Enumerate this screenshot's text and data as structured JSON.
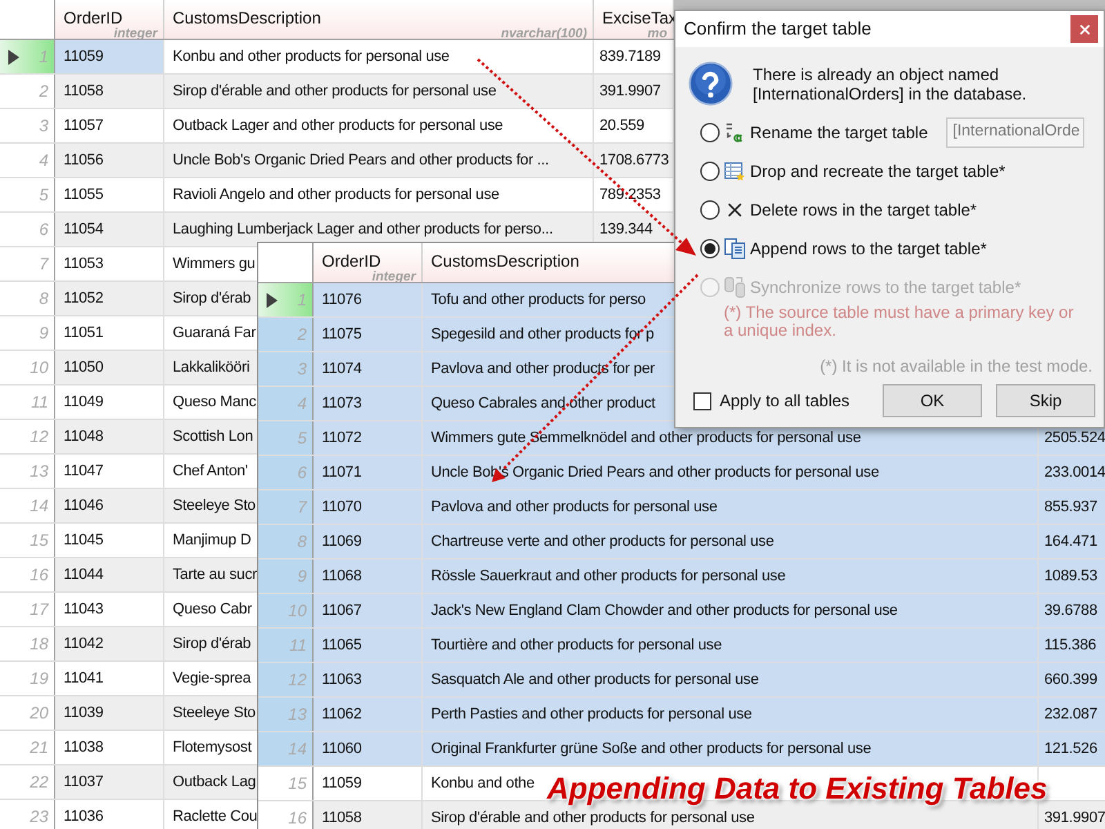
{
  "back_table": {
    "columns": [
      {
        "name": "OrderID",
        "type": "integer"
      },
      {
        "name": "CustomsDescription",
        "type": "nvarchar(100)"
      },
      {
        "name": "ExciseTax",
        "type": "mo"
      }
    ],
    "rows": [
      {
        "number": "1",
        "order_id": "11059",
        "description": "Konbu and other products for personal use",
        "excise_tax": "839.7189",
        "current": true,
        "cell_focused": true
      },
      {
        "number": "2",
        "order_id": "11058",
        "description": "Sirop d'érable and other products for personal use",
        "excise_tax": "391.9907",
        "current": false,
        "cell_focused": false
      },
      {
        "number": "3",
        "order_id": "11057",
        "description": "Outback Lager and other products for personal use",
        "excise_tax": "20.559",
        "current": false,
        "cell_focused": false
      },
      {
        "number": "4",
        "order_id": "11056",
        "description": "Uncle Bob's Organic Dried Pears and other products for ...",
        "excise_tax": "1708.6773",
        "current": false,
        "cell_focused": false
      },
      {
        "number": "5",
        "order_id": "11055",
        "description": "Ravioli Angelo and other products for personal use",
        "excise_tax": "789.2353",
        "current": false,
        "cell_focused": false
      },
      {
        "number": "6",
        "order_id": "11054",
        "description": "Laughing Lumberjack Lager and other products for perso...",
        "excise_tax": "139.344",
        "current": false,
        "cell_focused": false
      },
      {
        "number": "7",
        "order_id": "11053",
        "description": "Wimmers gu",
        "current": false,
        "cell_focused": false
      },
      {
        "number": "8",
        "order_id": "11052",
        "description": "Sirop d'érab",
        "current": false,
        "cell_focused": false
      },
      {
        "number": "9",
        "order_id": "11051",
        "description": "Guaraná Far",
        "current": false,
        "cell_focused": false
      },
      {
        "number": "10",
        "order_id": "11050",
        "description": "Lakkalikööri",
        "current": false,
        "cell_focused": false
      },
      {
        "number": "11",
        "order_id": "11049",
        "description": "Queso Manc",
        "current": false,
        "cell_focused": false
      },
      {
        "number": "12",
        "order_id": "11048",
        "description": "Scottish Lon",
        "current": false,
        "cell_focused": false
      },
      {
        "number": "13",
        "order_id": "11047",
        "description": "Chef Anton'",
        "current": false,
        "cell_focused": false
      },
      {
        "number": "14",
        "order_id": "11046",
        "description": "Steeleye Sto",
        "current": false,
        "cell_focused": false
      },
      {
        "number": "15",
        "order_id": "11045",
        "description": "Manjimup D",
        "current": false,
        "cell_focused": false
      },
      {
        "number": "16",
        "order_id": "11044",
        "description": "Tarte au sucr",
        "current": false,
        "cell_focused": false
      },
      {
        "number": "17",
        "order_id": "11043",
        "description": "Queso Cabr",
        "current": false,
        "cell_focused": false
      },
      {
        "number": "18",
        "order_id": "11042",
        "description": "Sirop d'érab",
        "current": false,
        "cell_focused": false
      },
      {
        "number": "19",
        "order_id": "11041",
        "description": "Vegie-sprea",
        "current": false,
        "cell_focused": false
      },
      {
        "number": "20",
        "order_id": "11039",
        "description": "Steeleye Sto",
        "current": false,
        "cell_focused": false
      },
      {
        "number": "21",
        "order_id": "11038",
        "description": "Flotemysost",
        "current": false,
        "cell_focused": false
      },
      {
        "number": "22",
        "order_id": "11037",
        "description": "Outback Lag",
        "current": false,
        "cell_focused": false
      },
      {
        "number": "23",
        "order_id": "11036",
        "description": "Raclette Cou",
        "current": false,
        "cell_focused": false
      }
    ]
  },
  "front_table": {
    "columns": [
      {
        "name": "OrderID",
        "type": "integer"
      },
      {
        "name": "CustomsDescription"
      }
    ],
    "rows": [
      {
        "number": "1",
        "order_id": "11076",
        "description": "Tofu and other products for perso",
        "current": true,
        "selected": true
      },
      {
        "number": "2",
        "order_id": "11075",
        "description": "Spegesild and other products for p",
        "current": false,
        "selected": true
      },
      {
        "number": "3",
        "order_id": "11074",
        "description": "Pavlova and other products for per",
        "current": false,
        "selected": true
      },
      {
        "number": "4",
        "order_id": "11073",
        "description": "Queso Cabrales and other product",
        "current": false,
        "selected": true
      },
      {
        "number": "5",
        "order_id": "11072",
        "description": "Wimmers gute Semmelknödel and other products for personal use",
        "excise_tax": "2505.524",
        "current": false,
        "selected": true
      },
      {
        "number": "6",
        "order_id": "11071",
        "description": "Uncle Bob's Organic Dried Pears and other products for personal use",
        "excise_tax": "233.0014",
        "current": false,
        "selected": true
      },
      {
        "number": "7",
        "order_id": "11070",
        "description": "Pavlova and other products for personal use",
        "excise_tax": "855.937",
        "current": false,
        "selected": true
      },
      {
        "number": "8",
        "order_id": "11069",
        "description": "Chartreuse verte and other products for personal use",
        "excise_tax": "164.471",
        "current": false,
        "selected": true
      },
      {
        "number": "9",
        "order_id": "11068",
        "description": "Rössle Sauerkraut and other products for personal use",
        "excise_tax": "1089.53",
        "current": false,
        "selected": true
      },
      {
        "number": "10",
        "order_id": "11067",
        "description": "Jack's New England Clam Chowder and other products for personal use",
        "excise_tax": "39.6788",
        "current": false,
        "selected": true
      },
      {
        "number": "11",
        "order_id": "11065",
        "description": "Tourtière and other products for personal use",
        "excise_tax": "115.386",
        "current": false,
        "selected": true
      },
      {
        "number": "12",
        "order_id": "11063",
        "description": "Sasquatch Ale and other products for personal use",
        "excise_tax": "660.399",
        "current": false,
        "selected": true
      },
      {
        "number": "13",
        "order_id": "11062",
        "description": "Perth Pasties and other products for personal use",
        "excise_tax": "232.087",
        "current": false,
        "selected": true
      },
      {
        "number": "14",
        "order_id": "11060",
        "description": "Original Frankfurter grüne Soße and other products for personal use",
        "excise_tax": "121.526",
        "current": false,
        "selected": true
      },
      {
        "number": "15",
        "order_id": "11059",
        "description": "Konbu and othe",
        "current": false,
        "selected": false
      },
      {
        "number": "16",
        "order_id": "11058",
        "description": "Sirop d'érable and other products for personal use",
        "excise_tax": "391.9907",
        "current": false,
        "selected": false
      }
    ]
  },
  "dialog": {
    "title": "Confirm the target table",
    "message": "There is already an object named [InternationalOrders] in the database.",
    "options": [
      {
        "kind": "rename",
        "label": "Rename the target table",
        "selected": false,
        "disabled": false,
        "field_value": "[InternationalOrde"
      },
      {
        "kind": "drop",
        "label": "Drop and recreate the target table*",
        "selected": false,
        "disabled": false
      },
      {
        "kind": "delete",
        "label": "Delete rows in the target table*",
        "selected": false,
        "disabled": false
      },
      {
        "kind": "append",
        "label": "Append rows to the target table*",
        "selected": true,
        "disabled": false
      },
      {
        "kind": "sync",
        "label": "Synchronize rows to the target table*",
        "selected": false,
        "disabled": true
      }
    ],
    "sync_note": "(*) The source table must have a primary key or a unique index.",
    "test_mode_note": "(*) It is not available in the test mode.",
    "apply_all": {
      "label": "Apply to all tables",
      "checked": false
    },
    "buttons": [
      "OK",
      "Skip"
    ]
  },
  "caption": "Appending Data to Existing Tables"
}
